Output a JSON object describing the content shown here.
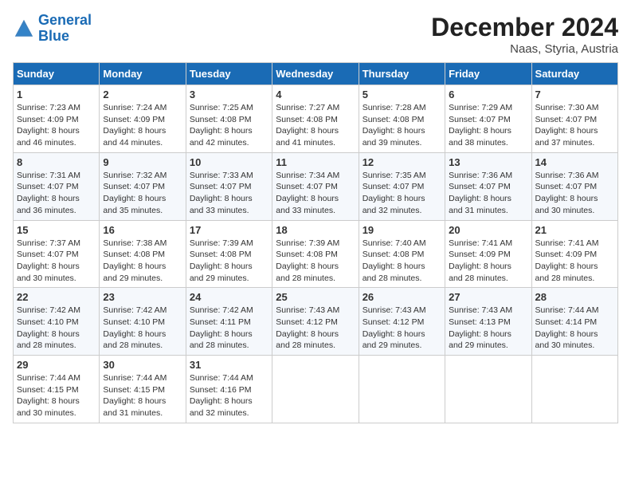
{
  "header": {
    "logo_line1": "General",
    "logo_line2": "Blue",
    "month": "December 2024",
    "location": "Naas, Styria, Austria"
  },
  "days_of_week": [
    "Sunday",
    "Monday",
    "Tuesday",
    "Wednesday",
    "Thursday",
    "Friday",
    "Saturday"
  ],
  "weeks": [
    [
      {
        "day": "1",
        "lines": [
          "Sunrise: 7:23 AM",
          "Sunset: 4:09 PM",
          "Daylight: 8 hours",
          "and 46 minutes."
        ]
      },
      {
        "day": "2",
        "lines": [
          "Sunrise: 7:24 AM",
          "Sunset: 4:09 PM",
          "Daylight: 8 hours",
          "and 44 minutes."
        ]
      },
      {
        "day": "3",
        "lines": [
          "Sunrise: 7:25 AM",
          "Sunset: 4:08 PM",
          "Daylight: 8 hours",
          "and 42 minutes."
        ]
      },
      {
        "day": "4",
        "lines": [
          "Sunrise: 7:27 AM",
          "Sunset: 4:08 PM",
          "Daylight: 8 hours",
          "and 41 minutes."
        ]
      },
      {
        "day": "5",
        "lines": [
          "Sunrise: 7:28 AM",
          "Sunset: 4:08 PM",
          "Daylight: 8 hours",
          "and 39 minutes."
        ]
      },
      {
        "day": "6",
        "lines": [
          "Sunrise: 7:29 AM",
          "Sunset: 4:07 PM",
          "Daylight: 8 hours",
          "and 38 minutes."
        ]
      },
      {
        "day": "7",
        "lines": [
          "Sunrise: 7:30 AM",
          "Sunset: 4:07 PM",
          "Daylight: 8 hours",
          "and 37 minutes."
        ]
      }
    ],
    [
      {
        "day": "8",
        "lines": [
          "Sunrise: 7:31 AM",
          "Sunset: 4:07 PM",
          "Daylight: 8 hours",
          "and 36 minutes."
        ]
      },
      {
        "day": "9",
        "lines": [
          "Sunrise: 7:32 AM",
          "Sunset: 4:07 PM",
          "Daylight: 8 hours",
          "and 35 minutes."
        ]
      },
      {
        "day": "10",
        "lines": [
          "Sunrise: 7:33 AM",
          "Sunset: 4:07 PM",
          "Daylight: 8 hours",
          "and 33 minutes."
        ]
      },
      {
        "day": "11",
        "lines": [
          "Sunrise: 7:34 AM",
          "Sunset: 4:07 PM",
          "Daylight: 8 hours",
          "and 33 minutes."
        ]
      },
      {
        "day": "12",
        "lines": [
          "Sunrise: 7:35 AM",
          "Sunset: 4:07 PM",
          "Daylight: 8 hours",
          "and 32 minutes."
        ]
      },
      {
        "day": "13",
        "lines": [
          "Sunrise: 7:36 AM",
          "Sunset: 4:07 PM",
          "Daylight: 8 hours",
          "and 31 minutes."
        ]
      },
      {
        "day": "14",
        "lines": [
          "Sunrise: 7:36 AM",
          "Sunset: 4:07 PM",
          "Daylight: 8 hours",
          "and 30 minutes."
        ]
      }
    ],
    [
      {
        "day": "15",
        "lines": [
          "Sunrise: 7:37 AM",
          "Sunset: 4:07 PM",
          "Daylight: 8 hours",
          "and 30 minutes."
        ]
      },
      {
        "day": "16",
        "lines": [
          "Sunrise: 7:38 AM",
          "Sunset: 4:08 PM",
          "Daylight: 8 hours",
          "and 29 minutes."
        ]
      },
      {
        "day": "17",
        "lines": [
          "Sunrise: 7:39 AM",
          "Sunset: 4:08 PM",
          "Daylight: 8 hours",
          "and 29 minutes."
        ]
      },
      {
        "day": "18",
        "lines": [
          "Sunrise: 7:39 AM",
          "Sunset: 4:08 PM",
          "Daylight: 8 hours",
          "and 28 minutes."
        ]
      },
      {
        "day": "19",
        "lines": [
          "Sunrise: 7:40 AM",
          "Sunset: 4:08 PM",
          "Daylight: 8 hours",
          "and 28 minutes."
        ]
      },
      {
        "day": "20",
        "lines": [
          "Sunrise: 7:41 AM",
          "Sunset: 4:09 PM",
          "Daylight: 8 hours",
          "and 28 minutes."
        ]
      },
      {
        "day": "21",
        "lines": [
          "Sunrise: 7:41 AM",
          "Sunset: 4:09 PM",
          "Daylight: 8 hours",
          "and 28 minutes."
        ]
      }
    ],
    [
      {
        "day": "22",
        "lines": [
          "Sunrise: 7:42 AM",
          "Sunset: 4:10 PM",
          "Daylight: 8 hours",
          "and 28 minutes."
        ]
      },
      {
        "day": "23",
        "lines": [
          "Sunrise: 7:42 AM",
          "Sunset: 4:10 PM",
          "Daylight: 8 hours",
          "and 28 minutes."
        ]
      },
      {
        "day": "24",
        "lines": [
          "Sunrise: 7:42 AM",
          "Sunset: 4:11 PM",
          "Daylight: 8 hours",
          "and 28 minutes."
        ]
      },
      {
        "day": "25",
        "lines": [
          "Sunrise: 7:43 AM",
          "Sunset: 4:12 PM",
          "Daylight: 8 hours",
          "and 28 minutes."
        ]
      },
      {
        "day": "26",
        "lines": [
          "Sunrise: 7:43 AM",
          "Sunset: 4:12 PM",
          "Daylight: 8 hours",
          "and 29 minutes."
        ]
      },
      {
        "day": "27",
        "lines": [
          "Sunrise: 7:43 AM",
          "Sunset: 4:13 PM",
          "Daylight: 8 hours",
          "and 29 minutes."
        ]
      },
      {
        "day": "28",
        "lines": [
          "Sunrise: 7:44 AM",
          "Sunset: 4:14 PM",
          "Daylight: 8 hours",
          "and 30 minutes."
        ]
      }
    ],
    [
      {
        "day": "29",
        "lines": [
          "Sunrise: 7:44 AM",
          "Sunset: 4:15 PM",
          "Daylight: 8 hours",
          "and 30 minutes."
        ]
      },
      {
        "day": "30",
        "lines": [
          "Sunrise: 7:44 AM",
          "Sunset: 4:15 PM",
          "Daylight: 8 hours",
          "and 31 minutes."
        ]
      },
      {
        "day": "31",
        "lines": [
          "Sunrise: 7:44 AM",
          "Sunset: 4:16 PM",
          "Daylight: 8 hours",
          "and 32 minutes."
        ]
      },
      {
        "day": "",
        "lines": []
      },
      {
        "day": "",
        "lines": []
      },
      {
        "day": "",
        "lines": []
      },
      {
        "day": "",
        "lines": []
      }
    ]
  ]
}
